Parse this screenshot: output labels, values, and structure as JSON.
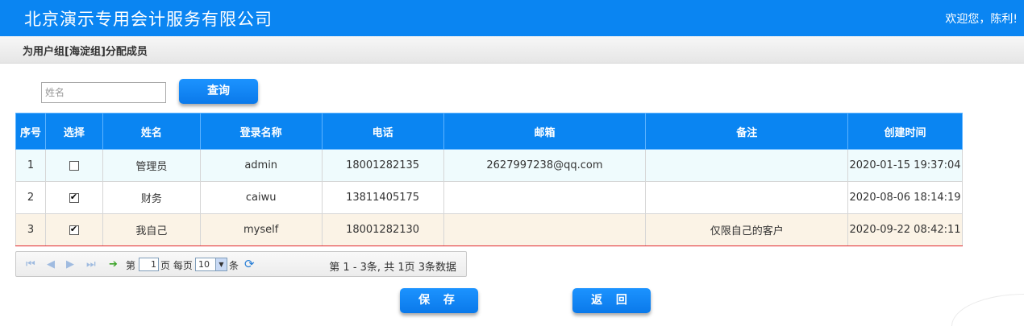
{
  "header": {
    "brand": "北京演示专用会计服务有限公司",
    "welcome": "欢迎您，陈利!"
  },
  "subheader": {
    "title": "为用户组[海淀组]分配成员"
  },
  "search": {
    "placeholder": "姓名",
    "value": "",
    "query_label": "查询"
  },
  "table": {
    "columns": [
      "序号",
      "选择",
      "姓名",
      "登录名称",
      "电话",
      "邮箱",
      "备注",
      "创建时间"
    ],
    "rows": [
      {
        "index": "1",
        "checked": false,
        "name": "管理员",
        "login": "admin",
        "phone": "18001282135",
        "email": "2627997238@qq.com",
        "note": "",
        "created": "2020-01-15 19:37:04"
      },
      {
        "index": "2",
        "checked": true,
        "name": "财务",
        "login": "caiwu",
        "phone": "13811405175",
        "email": "",
        "note": "",
        "created": "2020-08-06 18:14:19"
      },
      {
        "index": "3",
        "checked": true,
        "name": "我自己",
        "login": "myself",
        "phone": "18001282130",
        "email": "",
        "note": "仅限自己的客户",
        "created": "2020-09-22 08:42:11"
      }
    ]
  },
  "pager": {
    "page_prefix": "第",
    "page_value": "1",
    "page_suffix": "页 每页",
    "page_size": "10",
    "size_suffix": "条",
    "info": "第 1 - 3条, 共 1页 3条数据"
  },
  "actions": {
    "save_label": "保 存",
    "back_label": "返 回"
  },
  "colors": {
    "primary": "#0a85f2",
    "row_highlight": "#fbf3e6",
    "row_alt": "#effbfd",
    "selected_border": "#e0262c"
  }
}
